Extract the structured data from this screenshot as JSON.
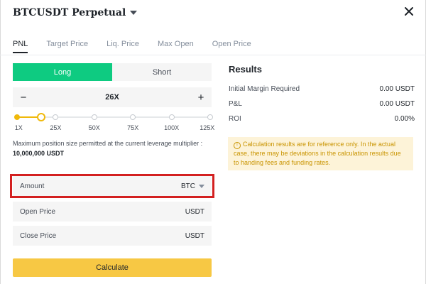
{
  "header": {
    "title": "BTCUSDT Perpetual"
  },
  "tabs": [
    {
      "label": "PNL",
      "active": true
    },
    {
      "label": "Target Price",
      "active": false
    },
    {
      "label": "Liq. Price",
      "active": false
    },
    {
      "label": "Max Open",
      "active": false
    },
    {
      "label": "Open Price",
      "active": false
    }
  ],
  "side_toggle": {
    "long_label": "Long",
    "short_label": "Short",
    "selected": "Long"
  },
  "leverage": {
    "minus": "−",
    "plus": "+",
    "value": "26X",
    "slider_fraction": 0.125,
    "ticks": [
      "1X",
      "25X",
      "50X",
      "75X",
      "100X",
      "125X"
    ]
  },
  "max_position": {
    "text": "Maximum position size permitted at the current leverage multiplier :",
    "value": "10,000,000 USDT"
  },
  "fields": {
    "amount": {
      "label": "Amount",
      "unit": "BTC"
    },
    "open_price": {
      "label": "Open Price",
      "unit": "USDT"
    },
    "close_price": {
      "label": "Close Price",
      "unit": "USDT"
    }
  },
  "calculate_label": "Calculate",
  "results": {
    "heading": "Results",
    "rows": [
      {
        "label": "Initial Margin Required",
        "value": "0.00 USDT"
      },
      {
        "label": "P&L",
        "value": "0.00 USDT"
      },
      {
        "label": "ROI",
        "value": "0.00%"
      }
    ]
  },
  "notice": {
    "icon": "info-icon",
    "text": "Calculation results are for reference only. In the actual case, there may be deviations in the calculation results due to handing fees and funding rates."
  },
  "colors": {
    "long": "#0ecb81",
    "accent": "#f0b90b",
    "highlight": "#d32020"
  }
}
